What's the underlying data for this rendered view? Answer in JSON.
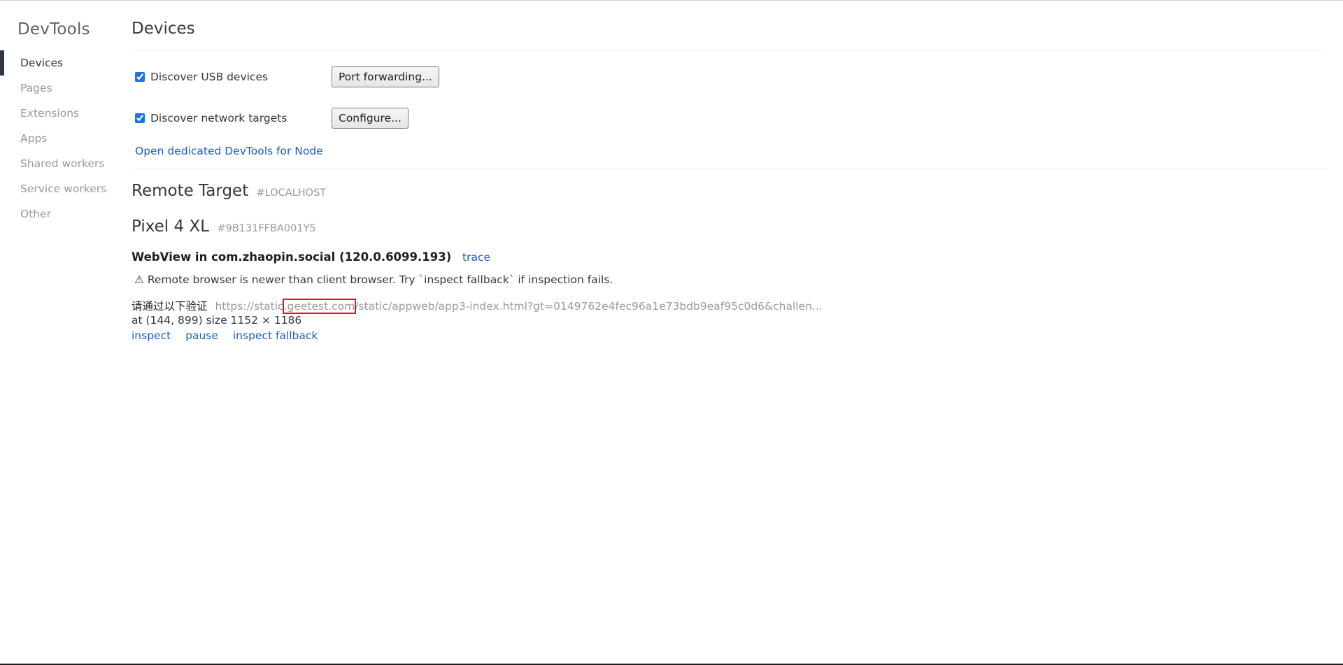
{
  "app": {
    "title": "DevTools"
  },
  "sidebar": {
    "items": [
      {
        "label": "Devices",
        "active": true
      },
      {
        "label": "Pages"
      },
      {
        "label": "Extensions"
      },
      {
        "label": "Apps"
      },
      {
        "label": "Shared workers"
      },
      {
        "label": "Service workers"
      },
      {
        "label": "Other"
      }
    ]
  },
  "main": {
    "title": "Devices",
    "usb": {
      "label": "Discover USB devices",
      "checked": true,
      "button": "Port forwarding..."
    },
    "network": {
      "label": "Discover network targets",
      "checked": true,
      "button": "Configure..."
    },
    "node_link": "Open dedicated DevTools for Node",
    "remote": {
      "title": "Remote Target",
      "tag": "#LOCALHOST"
    },
    "device": {
      "name": "Pixel 4 XL",
      "serial": "#9B131FFBA001Y5"
    },
    "webview": {
      "title": "WebView in com.zhaopin.social (120.0.6099.193)",
      "trace": "trace"
    },
    "warning": "⚠ Remote browser is newer than client browser. Try `inspect fallback` if inspection fails.",
    "target": {
      "name": "请通过以下验证",
      "url_prefix": "https://static",
      "url_highlight": ".geetest.com",
      "url_suffix": "/static/appweb/app3-index.html?gt=0149762e4fec96a1e73bdb9eaf95c0d6&challen...",
      "position": "at (144, 899)  size 1152 × 1186"
    },
    "actions": {
      "inspect": "inspect",
      "pause": "pause",
      "fallback": "inspect fallback"
    }
  },
  "colors": {
    "accent": "#1a5fc0",
    "highlight_box": "#e0161a"
  }
}
